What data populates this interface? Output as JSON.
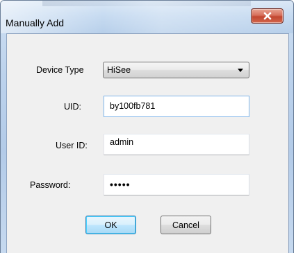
{
  "window": {
    "title": "Manually Add",
    "close_icon": "close-icon"
  },
  "form": {
    "device_type": {
      "label": "Device Type",
      "selected": "HiSee"
    },
    "uid": {
      "label": "UID:",
      "value": "by100fb781"
    },
    "user_id": {
      "label": "User ID:",
      "value": "admin"
    },
    "password": {
      "label": "Password:",
      "masked_value": "•••••"
    }
  },
  "buttons": {
    "ok": "OK",
    "cancel": "Cancel"
  },
  "colors": {
    "close_button": "#c9503a",
    "default_button_border": "#3c7fb1",
    "focus_border": "#7eb4ea"
  }
}
